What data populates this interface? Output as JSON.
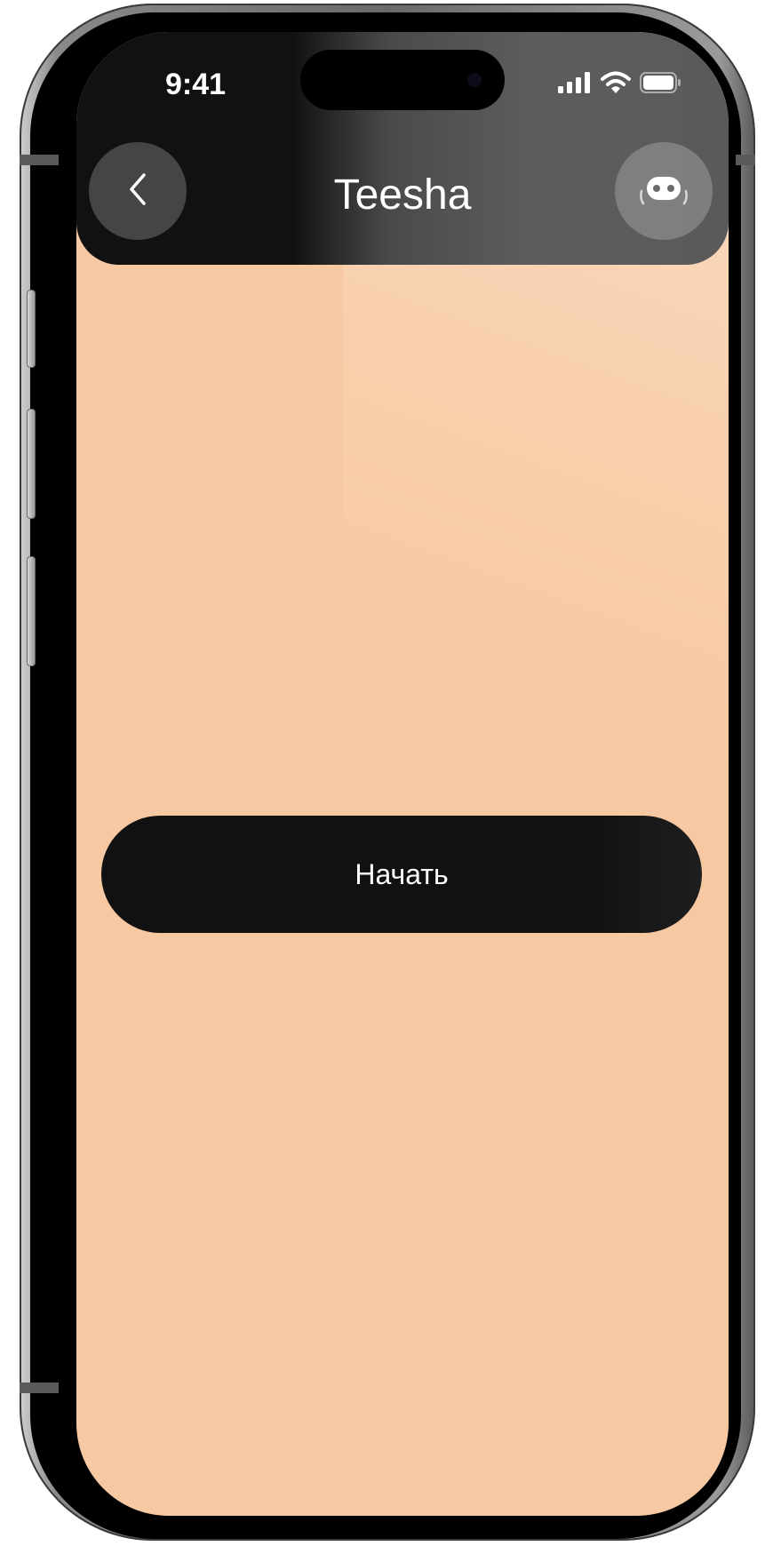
{
  "status_bar": {
    "time": "9:41",
    "icons": [
      "cellular-signal-icon",
      "wifi-icon",
      "battery-icon"
    ]
  },
  "header": {
    "title": "Teesha",
    "back_icon": "chevron-left-icon",
    "assistant_icon": "robot-icon"
  },
  "main": {
    "start_label": "Начать"
  },
  "colors": {
    "screen_background": "#f7c9a2",
    "header_background": "#111111",
    "button_background": "#111111",
    "text_on_dark": "#ffffff"
  }
}
